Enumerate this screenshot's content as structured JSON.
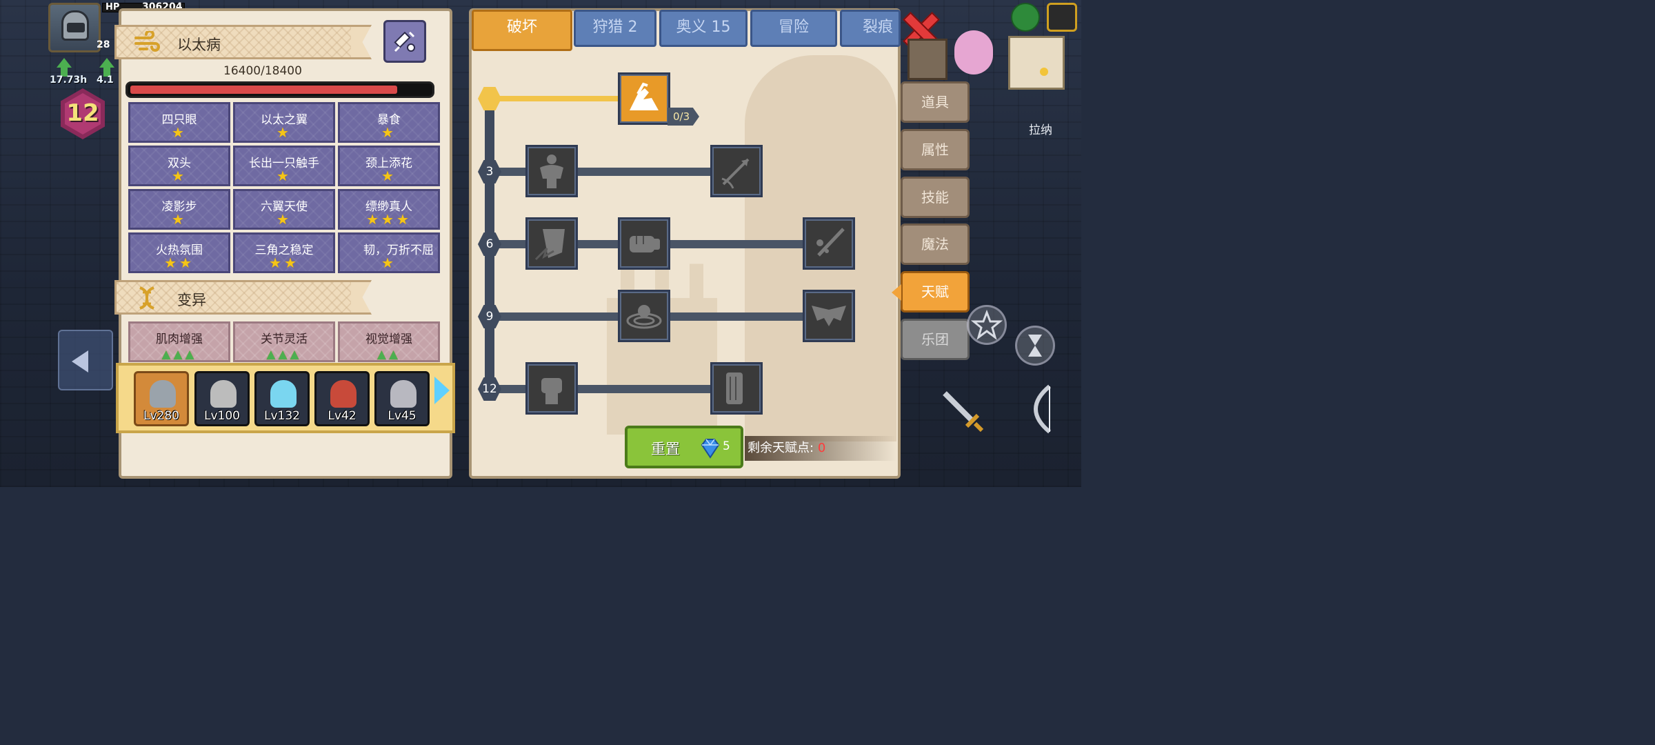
{
  "hud": {
    "hp_label": "HP",
    "hp_value": "306204",
    "level_partial": "28",
    "timers": [
      "17.73h",
      "4.1"
    ],
    "player_level": "12",
    "npc_name": "拉纳"
  },
  "left_panel": {
    "disease": {
      "title": "以太病",
      "hp_text": "16400/18400",
      "hp_fraction": 0.891
    },
    "traits": [
      {
        "name": "四只眼",
        "stars": "★"
      },
      {
        "name": "以太之翼",
        "stars": "★"
      },
      {
        "name": "暴食",
        "stars": "★"
      },
      {
        "name": "双头",
        "stars": "★"
      },
      {
        "name": "长出一只触手",
        "stars": "★"
      },
      {
        "name": "颈上添花",
        "stars": "★"
      },
      {
        "name": "凌影步",
        "stars": "★"
      },
      {
        "name": "六翼天使",
        "stars": "★"
      },
      {
        "name": "缥缈真人",
        "stars": "★★★"
      },
      {
        "name": "火热氛围",
        "stars": "★★"
      },
      {
        "name": "三角之稳定",
        "stars": "★★"
      },
      {
        "name": "韧，万折不屈",
        "stars": "★"
      }
    ],
    "mutation": {
      "title": "变异",
      "items": [
        {
          "name": "肌肉增强",
          "marks": "▲▲▲"
        },
        {
          "name": "关节灵活",
          "marks": "▲▲▲"
        },
        {
          "name": "视觉增强",
          "marks": "▲▲"
        }
      ]
    },
    "heroes": [
      {
        "level": "Lv280",
        "color": "#9aa3ab"
      },
      {
        "level": "Lv100",
        "color": "#bcbcbc"
      },
      {
        "level": "Lv132",
        "color": "#7ad6f0"
      },
      {
        "level": "Lv42",
        "color": "#c84a3a"
      },
      {
        "level": "Lv45",
        "color": "#b8b8c0"
      }
    ]
  },
  "right_panel": {
    "tabs": [
      "破坏",
      "狩猎 2",
      "奥义 15",
      "冒险",
      "裂痕"
    ],
    "tier_labels": [
      "3",
      "6",
      "9",
      "12"
    ],
    "top_skill_progress": "0/3",
    "reset_label": "重置",
    "reset_cost": "5",
    "points_label": "剩余天赋点:",
    "points_value": "0"
  },
  "side_menu": [
    "道具",
    "属性",
    "技能",
    "魔法",
    "天赋",
    "乐团"
  ],
  "colors": {
    "accent": "#e8a33a",
    "tab_inactive": "#5e7fb6",
    "trait_bg": "#6f6aa2",
    "hp_bar": "#d94a4a",
    "star": "#f5c518",
    "mutation_mark": "#4caf50",
    "reset_green": "#8ac43a"
  }
}
